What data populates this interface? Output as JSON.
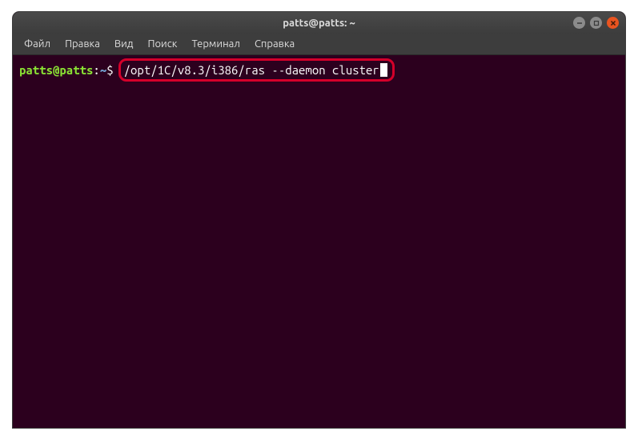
{
  "titlebar": {
    "title": "patts@patts: ~"
  },
  "menubar": {
    "items": [
      {
        "label": "Файл"
      },
      {
        "label": "Правка"
      },
      {
        "label": "Вид"
      },
      {
        "label": "Поиск"
      },
      {
        "label": "Терминал"
      },
      {
        "label": "Справка"
      }
    ]
  },
  "prompt": {
    "user_host": "patts@patts",
    "colon": ":",
    "path": "~",
    "symbol": "$"
  },
  "command": {
    "text": "/opt/1C/v8.3/i386/ras --daemon cluster"
  }
}
